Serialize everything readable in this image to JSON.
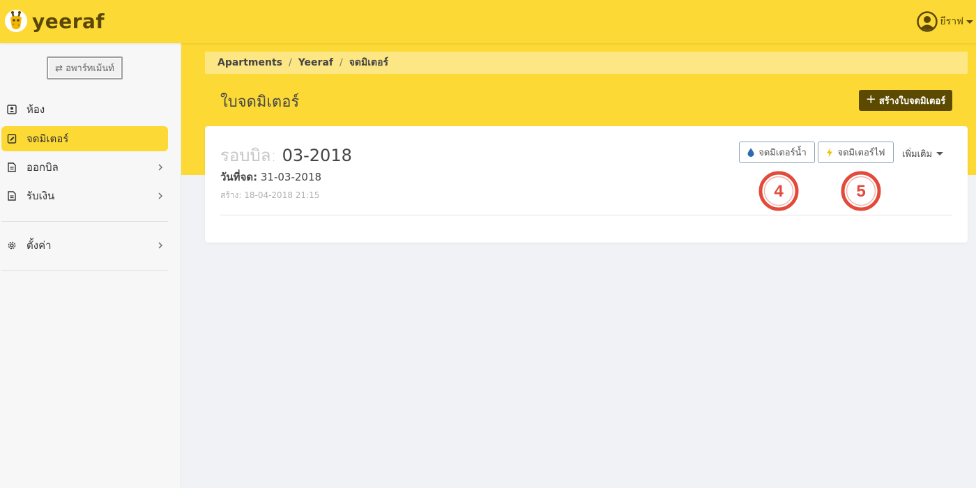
{
  "app": {
    "brand": "yeeraf",
    "user": "ยีราฟ",
    "colors": {
      "accent": "#fcd935",
      "dark": "#5c4a00",
      "water": "#2b6cb0",
      "electric": "#f2c200",
      "marker": "#e24b3b"
    }
  },
  "sidebar": {
    "switch_label": "⇄ อพาร์ทเม้นท์",
    "items": [
      {
        "label": "ห้อง",
        "icon": "contact-card-icon",
        "active": false,
        "has_chevron": false
      },
      {
        "label": "จดมิเตอร์",
        "icon": "edit-document-icon",
        "active": true,
        "has_chevron": false
      },
      {
        "label": "ออกบิล",
        "icon": "document-icon",
        "active": false,
        "has_chevron": true
      },
      {
        "label": "รับเงิน",
        "icon": "document-icon",
        "active": false,
        "has_chevron": true
      }
    ],
    "settings_label": "ตั้งค่า"
  },
  "breadcrumb": [
    "Apartments",
    "Yeeraf",
    "จดมิเตอร์"
  ],
  "page": {
    "title": "ใบจดมิเตอร์",
    "create_label": "สร้างใบจดมิเตอร์"
  },
  "card": {
    "cycle_label": "รอบบิล:",
    "cycle_value": "03-2018",
    "read_date_label": "วันที่จด:",
    "read_date_value": "31-03-2018",
    "created_text": "สร้าง: 18-04-2018 21:15",
    "water_label": "จดมิเตอร์น้ำ",
    "electric_label": "จดมิเตอร์ไฟ",
    "more_label": "เพิ่มเติม"
  },
  "markers": [
    "4",
    "5"
  ]
}
